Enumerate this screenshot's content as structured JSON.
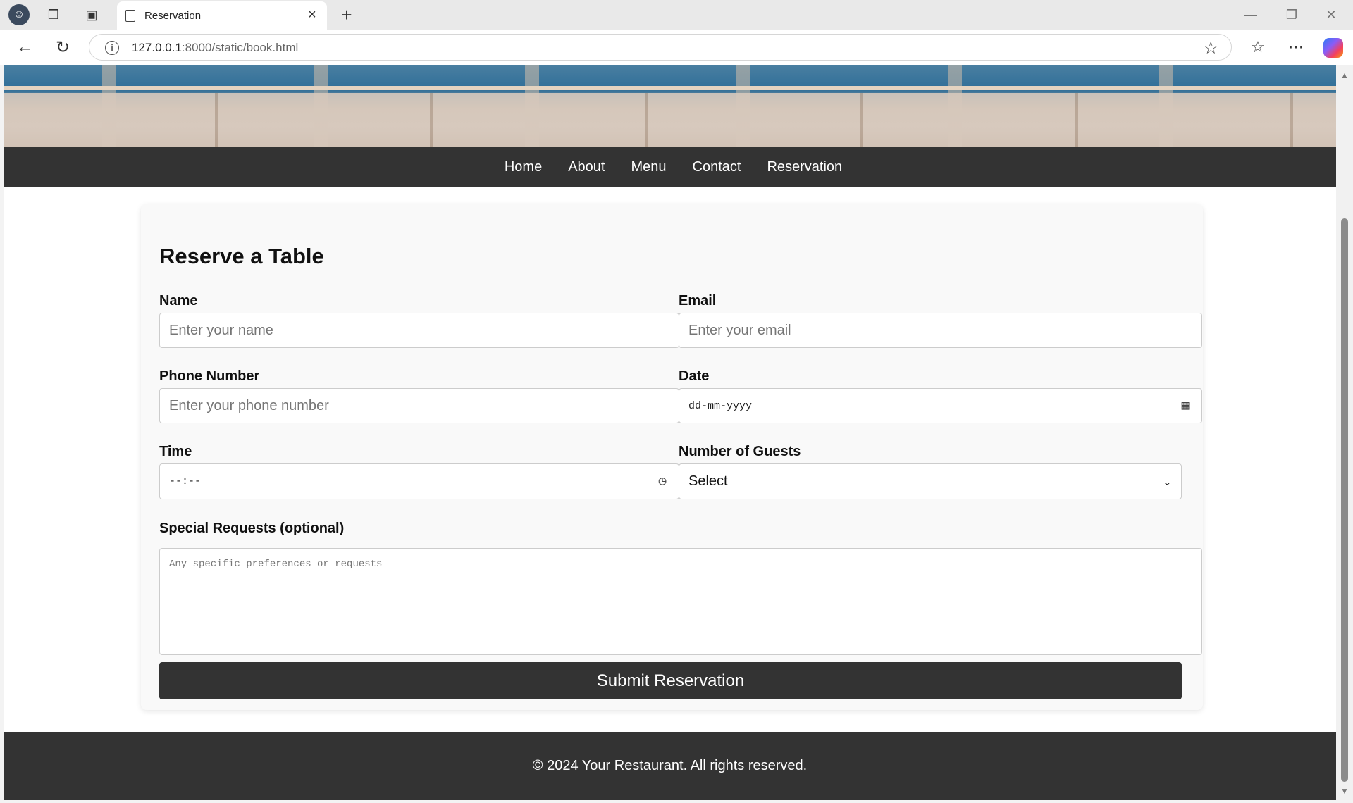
{
  "browser": {
    "tab_title": "Reservation",
    "url_host": "127.0.0.1",
    "url_rest": ":8000/static/book.html"
  },
  "nav": {
    "items": [
      {
        "label": "Home"
      },
      {
        "label": "About"
      },
      {
        "label": "Menu"
      },
      {
        "label": "Contact"
      },
      {
        "label": "Reservation"
      }
    ]
  },
  "form": {
    "title": "Reserve a Table",
    "name_label": "Name",
    "name_placeholder": "Enter your name",
    "email_label": "Email",
    "email_placeholder": "Enter your email",
    "phone_label": "Phone Number",
    "phone_placeholder": "Enter your phone number",
    "date_label": "Date",
    "date_value": "dd-mm-yyyy",
    "time_label": "Time",
    "time_value": "--:--",
    "guests_label": "Number of Guests",
    "guests_selected": "Select",
    "requests_label": "Special Requests (optional)",
    "requests_placeholder": "Any specific preferences or requests",
    "submit_label": "Submit Reservation"
  },
  "footer": {
    "text": "© 2024 Your Restaurant. All rights reserved."
  },
  "icons": {
    "profile": "profile-avatar-icon",
    "date": "calendar-icon",
    "time": "clock-icon"
  }
}
